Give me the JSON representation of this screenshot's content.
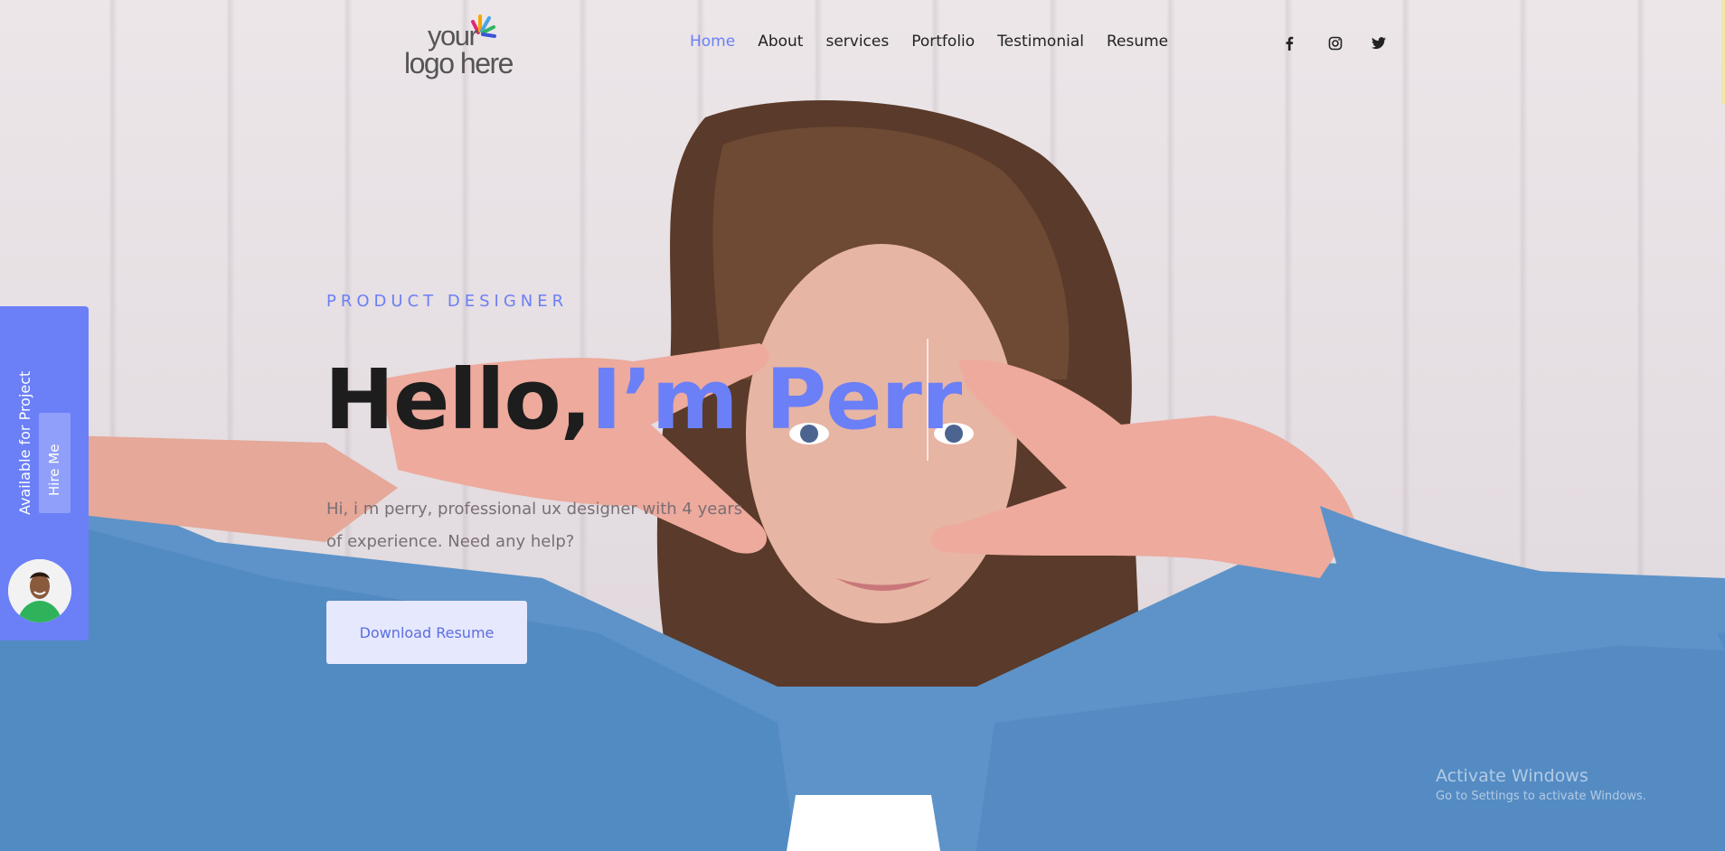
{
  "header": {
    "logo_line1": "your",
    "logo_line2": "logo here",
    "nav": [
      {
        "label": "Home",
        "active": true
      },
      {
        "label": "About",
        "active": false
      },
      {
        "label": "services",
        "active": false
      },
      {
        "label": "Portfolio",
        "active": false
      },
      {
        "label": "Testimonial",
        "active": false
      },
      {
        "label": "Resume",
        "active": false
      }
    ],
    "social_icons": [
      "facebook-icon",
      "instagram-icon",
      "twitter-icon"
    ],
    "social_glyphs": [
      "f",
      "◎",
      "🐦"
    ]
  },
  "hero": {
    "subtitle": "PRODUCT DESIGNER",
    "greeting": "Hello,",
    "name_typed": "I’m Perr",
    "intro": "Hi, i m perry, professional ux designer with 4 years of experience. Need any help?",
    "download_label": "Download Resume"
  },
  "sidebar": {
    "availability": "Available for Project",
    "hire_label": "Hire Me"
  },
  "watermark": {
    "title": "Activate Windows",
    "subtitle": "Go to Settings to activate Windows."
  },
  "colors": {
    "accent": "#6b7ff7",
    "button_bg": "#e6e8fd",
    "text_dark": "#1d1d1d"
  }
}
